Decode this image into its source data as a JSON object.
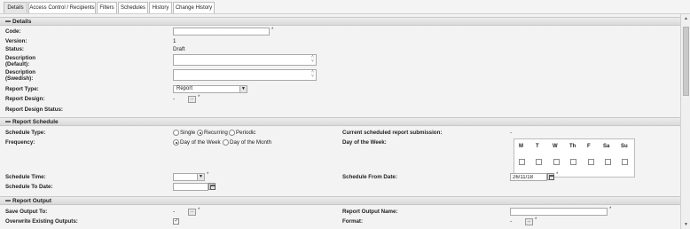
{
  "tabs": [
    "Details",
    "Access Control / Recipients",
    "Filters",
    "Schedules",
    "History",
    "Change History"
  ],
  "details": {
    "title": "Details",
    "code_label": "Code:",
    "code_value": "",
    "version_label": "Version:",
    "version_value": "1",
    "status_label": "Status:",
    "status_value": "Draft",
    "desc_default_label": "Description (Default):",
    "desc_swedish_label": "Description (Swedish):",
    "report_type_label": "Report Type:",
    "report_type_value": "Report",
    "report_design_label": "Report Design:",
    "report_design_value": "-",
    "report_design_status_label": "Report Design Status:"
  },
  "schedule": {
    "title": "Report Schedule",
    "type_label": "Schedule Type:",
    "type_options": [
      "Single",
      "Recurring",
      "Periodic"
    ],
    "type_selected": "Recurring",
    "frequency_label": "Frequency:",
    "frequency_options": [
      "Day of the Week",
      "Day of the Month"
    ],
    "frequency_selected": "Day of the Week",
    "current_submission_label": "Current scheduled report submission:",
    "current_submission_value": "-",
    "day_of_week_label": "Day of the Week:",
    "days": [
      "M",
      "T",
      "W",
      "Th",
      "F",
      "Sa",
      "Su"
    ],
    "time_label": "Schedule Time:",
    "to_date_label": "Schedule To Date:",
    "from_date_label": "Schedule From Date:",
    "from_date_value": "26/11/18"
  },
  "output": {
    "title": "Report Output",
    "save_to_label": "Save Output To:",
    "save_to_value": "-",
    "overwrite_label": "Overwrite Existing Outputs:",
    "overwrite_checked": true,
    "output_name_label": "Report Output Name:",
    "format_label": "Format:",
    "format_value": "-"
  },
  "required_marker": "*",
  "lookup_glyph": "...",
  "collapse_glyph": "▬"
}
